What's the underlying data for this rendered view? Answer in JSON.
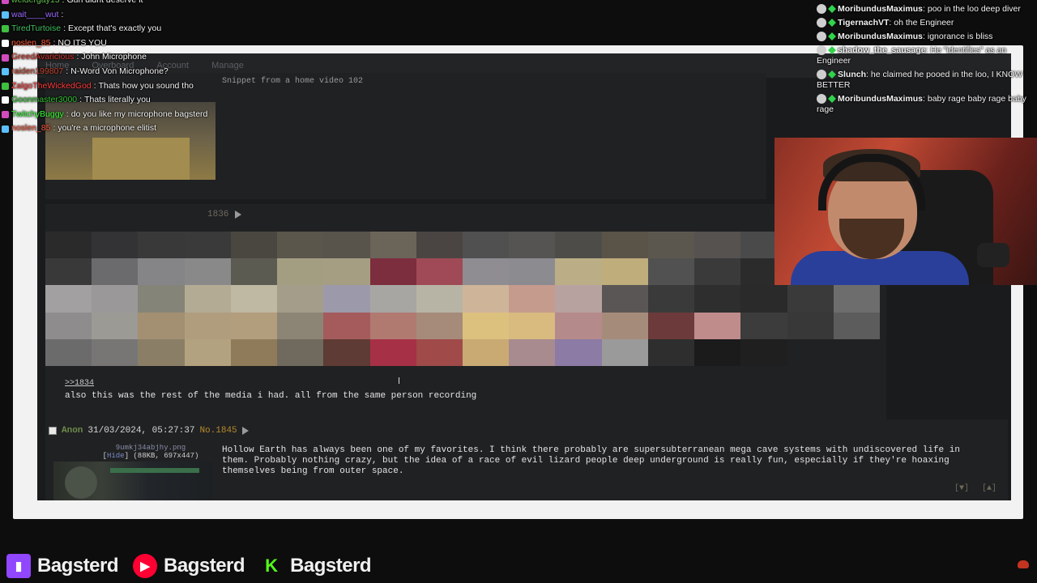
{
  "nav": {
    "items": [
      "Home",
      "Overboard",
      "Account",
      "Manage"
    ]
  },
  "post_a": {
    "snippet": "Snippet from a  home video  102"
  },
  "post_b": {
    "number": "1836",
    "quote": ">>1834",
    "body": "also this was the rest of the media i had. all from the same person recording"
  },
  "post_c": {
    "name": "Anon",
    "date": "31/03/2024, 05:27:37",
    "number": "No.1845",
    "file_name": "9umkj34abjhy.png",
    "file_hide": "Hide",
    "file_meta": "(88KB, 697x447)",
    "body": "Hollow Earth has always been one of my favorites. I think there probably are supersubterranean mega cave systems with undiscovered life in them. Probably nothing crazy, but the idea of a race of evil lizard people deep underground is really fun, especially if they're hoaxing themselves being from outer space.",
    "arrow_down": "[▼]",
    "arrow_up": "[▲]"
  },
  "chat_left": [
    {
      "user": "weldergay13",
      "text": "Gun didnt deserve it",
      "color": "#5fbf4a"
    },
    {
      "user": "wait____wut",
      "text": "",
      "color": "#9b6bff"
    },
    {
      "user": "TiredTurtoise",
      "text": "Except that's exactly you",
      "color": "#3fbf5f"
    },
    {
      "user": "noslen_85",
      "text": "NO ITS YOU",
      "color": "#ff5a3c"
    },
    {
      "user": "GreedAvaricious",
      "text": "John Microphone",
      "color": "#d2352b"
    },
    {
      "user": "raiden199807",
      "text": "N-Word Von Microphone?",
      "color": "#c3452e"
    },
    {
      "user": "ZalgoTheWickedGod",
      "text": "Thats how you sound tho",
      "color": "#ff3b3b"
    },
    {
      "user": "Goonmaster3000",
      "text": "Thats literally you",
      "color": "#2fbf2f"
    },
    {
      "user": "TwitchyBuggy",
      "text": "do you like my microphone bagsterd",
      "color": "#3cff3c"
    },
    {
      "user": "noslen_85",
      "text": "you're a microphone elitist",
      "color": "#ff5a3c"
    }
  ],
  "chat_right": [
    {
      "user": "MoribundusMaximus",
      "text": "poo in the loo deep diver"
    },
    {
      "user": "TigernachVT",
      "text": "oh the Engineer"
    },
    {
      "user": "MoribundusMaximus",
      "text": "ignorance is bliss"
    },
    {
      "user": "shadow_the_sausage",
      "text": "He \"identifies\" as an Engineer"
    },
    {
      "user": "Slunch",
      "text": "he claimed he pooed in the loo, I KNOW BETTER"
    },
    {
      "user": "MoribundusMaximus",
      "text": "baby rage baby rage baby rage"
    }
  ],
  "banner": {
    "twitch": {
      "icon": "twitch-icon",
      "name": "Bagsterd",
      "color": "#9146ff"
    },
    "youtube": {
      "icon": "youtube-icon",
      "name": "Bagsterd",
      "color": "#ff0033"
    },
    "kick": {
      "icon": "kick-icon",
      "name": "Bagsterd",
      "color": "#53fc18"
    }
  },
  "mosaic_colors": [
    "#2a2a2b",
    "#333234",
    "#3a393a",
    "#3a3a3a",
    "#4a4740",
    "#5a564c",
    "#58544c",
    "#6b6459",
    "#4a4542",
    "#505050",
    "#555452",
    "#4d4c48",
    "#5a5448",
    "#5b574f",
    "#565250",
    "#4a4a4a",
    "#2d2d2f",
    "#2a2a2b",
    "#3a393a",
    "#6b6a6c",
    "#858587",
    "#8a898a",
    "#5c5b52",
    "#a39e82",
    "#a59e82",
    "#7c2d3e",
    "#a04a57",
    "#8f8d91",
    "#8c8b90",
    "#bbae86",
    "#bfad7c",
    "#515151",
    "#3a3a3a",
    "#2b2b2c",
    "#3d3c3d",
    "#8d8a8b",
    "#a3a0a1",
    "#9a9898",
    "#858479",
    "#b4ab95",
    "#bfb8a2",
    "#a49d89",
    "#9c9aaa",
    "#a7a6a3",
    "#b8b4a5",
    "#ceb59a",
    "#c59b8d",
    "#b7a2a0",
    "#5a5656",
    "#3a3a3a",
    "#2e2e2e",
    "#2a2a2a",
    "#3a3a3a",
    "#6e6d6e",
    "#8e8c8d",
    "#9c9a95",
    "#a38f72",
    "#b09d7e",
    "#b29d7d",
    "#8c8575",
    "#a55b5c",
    "#b07a71",
    "#a68b7a",
    "#dcc07e",
    "#d9ba7f",
    "#b58a8a",
    "#a58c7a",
    "#6c3a3b",
    "#c08b8b",
    "#3c3c3c",
    "#383838",
    "#5c5c5c",
    "#6b6b6c",
    "#787675",
    "#8a7f66",
    "#b3a27f",
    "#8f7b5a",
    "#706a5e",
    "#5e3b34",
    "#a63046",
    "#a04a4a",
    "#c9aa73",
    "#a88b8f",
    "#8c7ba5",
    "#9a9a9a",
    "#2e2e2e",
    "#1b1b1b",
    "#1f1f1f"
  ]
}
